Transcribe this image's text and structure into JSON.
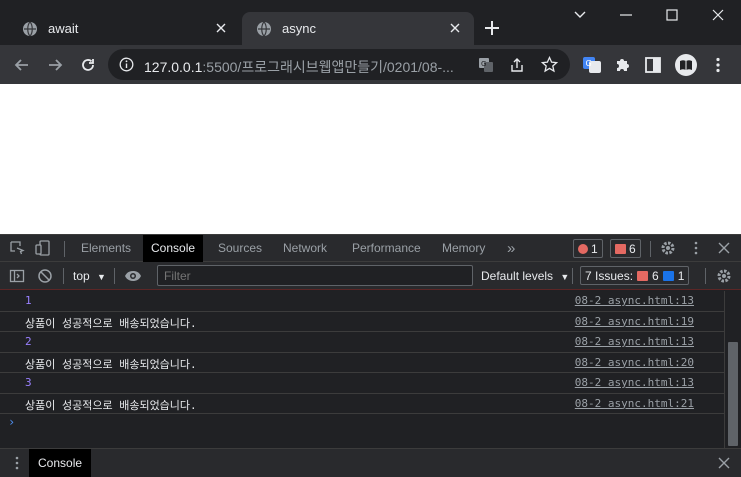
{
  "tabs": [
    {
      "title": "await"
    },
    {
      "title": "async"
    }
  ],
  "address": {
    "host": "127.0.0.1",
    "rest": ":5500/프로그래시브웹앱만들기/0201/08-..."
  },
  "devtools": {
    "tabs": [
      "Elements",
      "Console",
      "Sources",
      "Network",
      "Performance",
      "Memory"
    ],
    "more": "»",
    "error_count": "1",
    "warn_count": "6",
    "context": "top",
    "filter_placeholder": "Filter",
    "levels": "Default levels",
    "issues_label": "7 Issues:",
    "issues_warn": "6",
    "issues_info": "1"
  },
  "console_rows": [
    {
      "msg": "1",
      "src": "08-2 async.html:13",
      "num": true
    },
    {
      "msg": "상품이 성공적으로 배송되었습니다.",
      "src": "08-2 async.html:19",
      "num": false
    },
    {
      "msg": "2",
      "src": "08-2 async.html:13",
      "num": true
    },
    {
      "msg": "상품이 성공적으로 배송되었습니다.",
      "src": "08-2 async.html:20",
      "num": false
    },
    {
      "msg": "3",
      "src": "08-2 async.html:13",
      "num": true
    },
    {
      "msg": "상품이 성공적으로 배송되었습니다.",
      "src": "08-2 async.html:21",
      "num": false
    }
  ],
  "prompt": "›",
  "drawer": {
    "tab": "Console"
  },
  "colors": {
    "accent_blue": "#1a73e8",
    "error_red": "#e46962",
    "log_number": "#9980ff"
  }
}
